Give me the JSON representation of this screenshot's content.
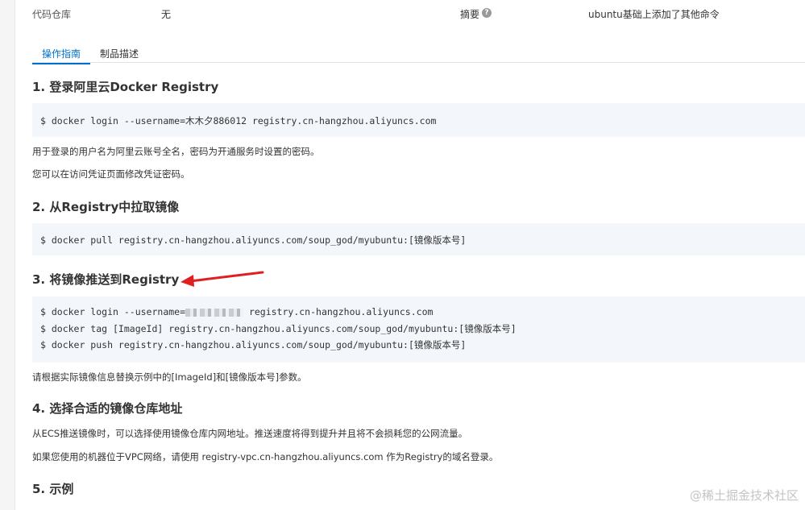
{
  "info": {
    "repo_label": "代码仓库",
    "repo_value": "无",
    "summary_label": "摘要",
    "help_icon": "?",
    "summary_value": "ubuntu基础上添加了其他命令"
  },
  "tabs": [
    {
      "label": "操作指南",
      "active": true
    },
    {
      "label": "制品描述",
      "active": false
    }
  ],
  "sections": {
    "s1": {
      "title": "1. 登录阿里云Docker Registry",
      "code": [
        "$ docker login --username=木木夕886012 registry.cn-hangzhou.aliyuncs.com"
      ],
      "notes": [
        "用于登录的用户名为阿里云账号全名，密码为开通服务时设置的密码。",
        "您可以在访问凭证页面修改凭证密码。"
      ]
    },
    "s2": {
      "title": "2. 从Registry中拉取镜像",
      "code": [
        "$ docker pull registry.cn-hangzhou.aliyuncs.com/soup_god/myubuntu:[镜像版本号]"
      ]
    },
    "s3": {
      "title": "3. 将镜像推送到Registry",
      "code_line1_prefix": "$ docker login --username=",
      "code_line1_suffix": " registry.cn-hangzhou.aliyuncs.com",
      "code": [
        "$ docker tag [ImageId] registry.cn-hangzhou.aliyuncs.com/soup_god/myubuntu:[镜像版本号]",
        "$ docker push registry.cn-hangzhou.aliyuncs.com/soup_god/myubuntu:[镜像版本号]"
      ],
      "note": "请根据实际镜像信息替换示例中的[ImageId]和[镜像版本号]参数。"
    },
    "s4": {
      "title": "4. 选择合适的镜像仓库地址",
      "notes": [
        "从ECS推送镜像时，可以选择使用镜像仓库内网地址。推送速度将得到提升并且将不会损耗您的公网流量。",
        "如果您使用的机器位于VPC网络，请使用 registry-vpc.cn-hangzhou.aliyuncs.com 作为Registry的域名登录。"
      ]
    },
    "s5": {
      "title": "5. 示例"
    }
  },
  "annotation_color": "#e02020",
  "watermark": "@稀土掘金技术社区"
}
